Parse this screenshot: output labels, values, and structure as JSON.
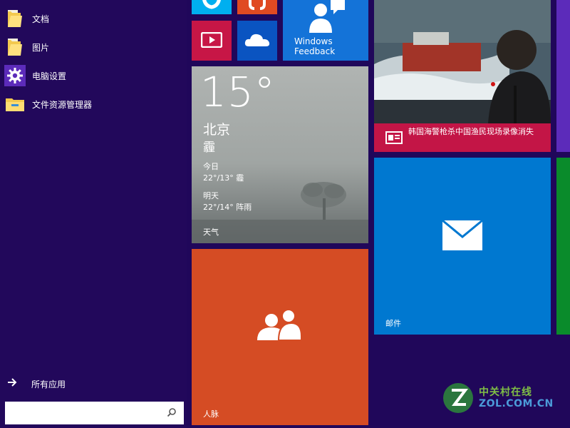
{
  "left_pane": {
    "items": [
      {
        "label": "文档",
        "icon": "folder-documents-icon"
      },
      {
        "label": "图片",
        "icon": "folder-pictures-icon"
      },
      {
        "label": "电脑设置",
        "icon": "gear-icon"
      },
      {
        "label": "文件资源管理器",
        "icon": "file-explorer-icon"
      }
    ],
    "all_apps": {
      "label": "所有应用",
      "icon": "arrow-right-icon"
    },
    "search": {
      "value": "",
      "placeholder": ""
    }
  },
  "tiles": {
    "weather": {
      "temp": "15°",
      "city": "北京",
      "condition": "霾",
      "today_label": "今日",
      "today_value": "22°/13° 霾",
      "tomorrow_label": "明天",
      "tomorrow_value": "22°/14° 阵雨",
      "label": "天气"
    },
    "people": {
      "label": "人脉",
      "icon": "people-icon"
    },
    "mail": {
      "label": "邮件",
      "icon": "mail-icon"
    },
    "news": {
      "caption": "韩国海警枪杀中国渔民现场录像消失",
      "icon": "news-icon"
    },
    "feedback": {
      "line1": "Windows",
      "line2": "Feedback",
      "icon": "feedback-icon"
    },
    "small": [
      {
        "icon": "skype-icon",
        "color": "#00aff0"
      },
      {
        "icon": "music-icon",
        "color": "#e04a22"
      },
      {
        "icon": "video-icon",
        "color": "#c71646"
      },
      {
        "icon": "onedrive-icon",
        "color": "#0a54c1"
      }
    ]
  },
  "watermark": {
    "line1": "中关村在线",
    "line2": "ZOL.COM.CN"
  },
  "colors": {
    "background": "#20075a",
    "weather_tile": "#9ea3a1",
    "people_tile": "#d54c24",
    "mail_tile": "#0078d0",
    "news_caption": "#c31546",
    "feedback_tile": "#1473d8"
  }
}
